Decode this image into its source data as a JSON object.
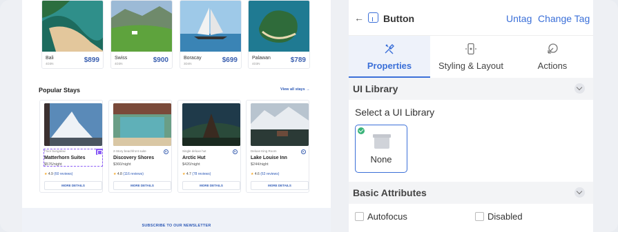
{
  "destinations": [
    {
      "name": "Bali",
      "sub": "4D3N",
      "price": "$899"
    },
    {
      "name": "Swiss",
      "sub": "4D3N",
      "price": "$900"
    },
    {
      "name": "Boracay",
      "sub": "3D4N",
      "price": "$699"
    },
    {
      "name": "Palawan",
      "sub": "4D3N",
      "price": "$789"
    }
  ],
  "popular": {
    "title": "Popular Stays",
    "view_all": "View all stays",
    "stays": [
      {
        "sub": "Floor bungalow",
        "name": "Matterhorn Suites",
        "price": "$576/night",
        "rating": "4.9",
        "reviews": "(60 reviews)",
        "button": "MORE DETAILS"
      },
      {
        "sub": "2-Story beachfront suite",
        "name": "Discovery Shores",
        "price": "$360/night",
        "rating": "4.8",
        "reviews": "(116 reviews)",
        "button": "MORE DETAILS"
      },
      {
        "sub": "Single deluxe hut",
        "name": "Arctic Hut",
        "price": "$420/night",
        "rating": "4.7",
        "reviews": "(78 reviews)",
        "button": "MORE DETAILS"
      },
      {
        "sub": "Deluxe King Room",
        "name": "Lake Louise Inn",
        "price": "$244/night",
        "rating": "4.6",
        "reviews": "(63 reviews)",
        "button": "MORE DETAILS"
      }
    ]
  },
  "newsletter": {
    "label": "SUBSCRIBE TO OUR NEWSLETTER"
  },
  "panel": {
    "title": "Button",
    "untag": "Untag",
    "change_tag": "Change Tag",
    "tabs": [
      {
        "label": "Properties",
        "icon": "tools-icon",
        "active": true
      },
      {
        "label": "Styling & Layout",
        "icon": "phone-layout-icon",
        "active": false
      },
      {
        "label": "Actions",
        "icon": "action-icon",
        "active": false
      }
    ],
    "ui_library": {
      "heading": "UI Library",
      "select_label": "Select a UI Library",
      "option": "None"
    },
    "basic_attributes": {
      "heading": "Basic Attributes",
      "autofocus": "Autofocus",
      "disabled": "Disabled"
    }
  },
  "colors": {
    "accent": "#3a6fd8",
    "price": "#3a5fb0",
    "selection": "#8b5cf6",
    "check": "#3ab37a"
  }
}
